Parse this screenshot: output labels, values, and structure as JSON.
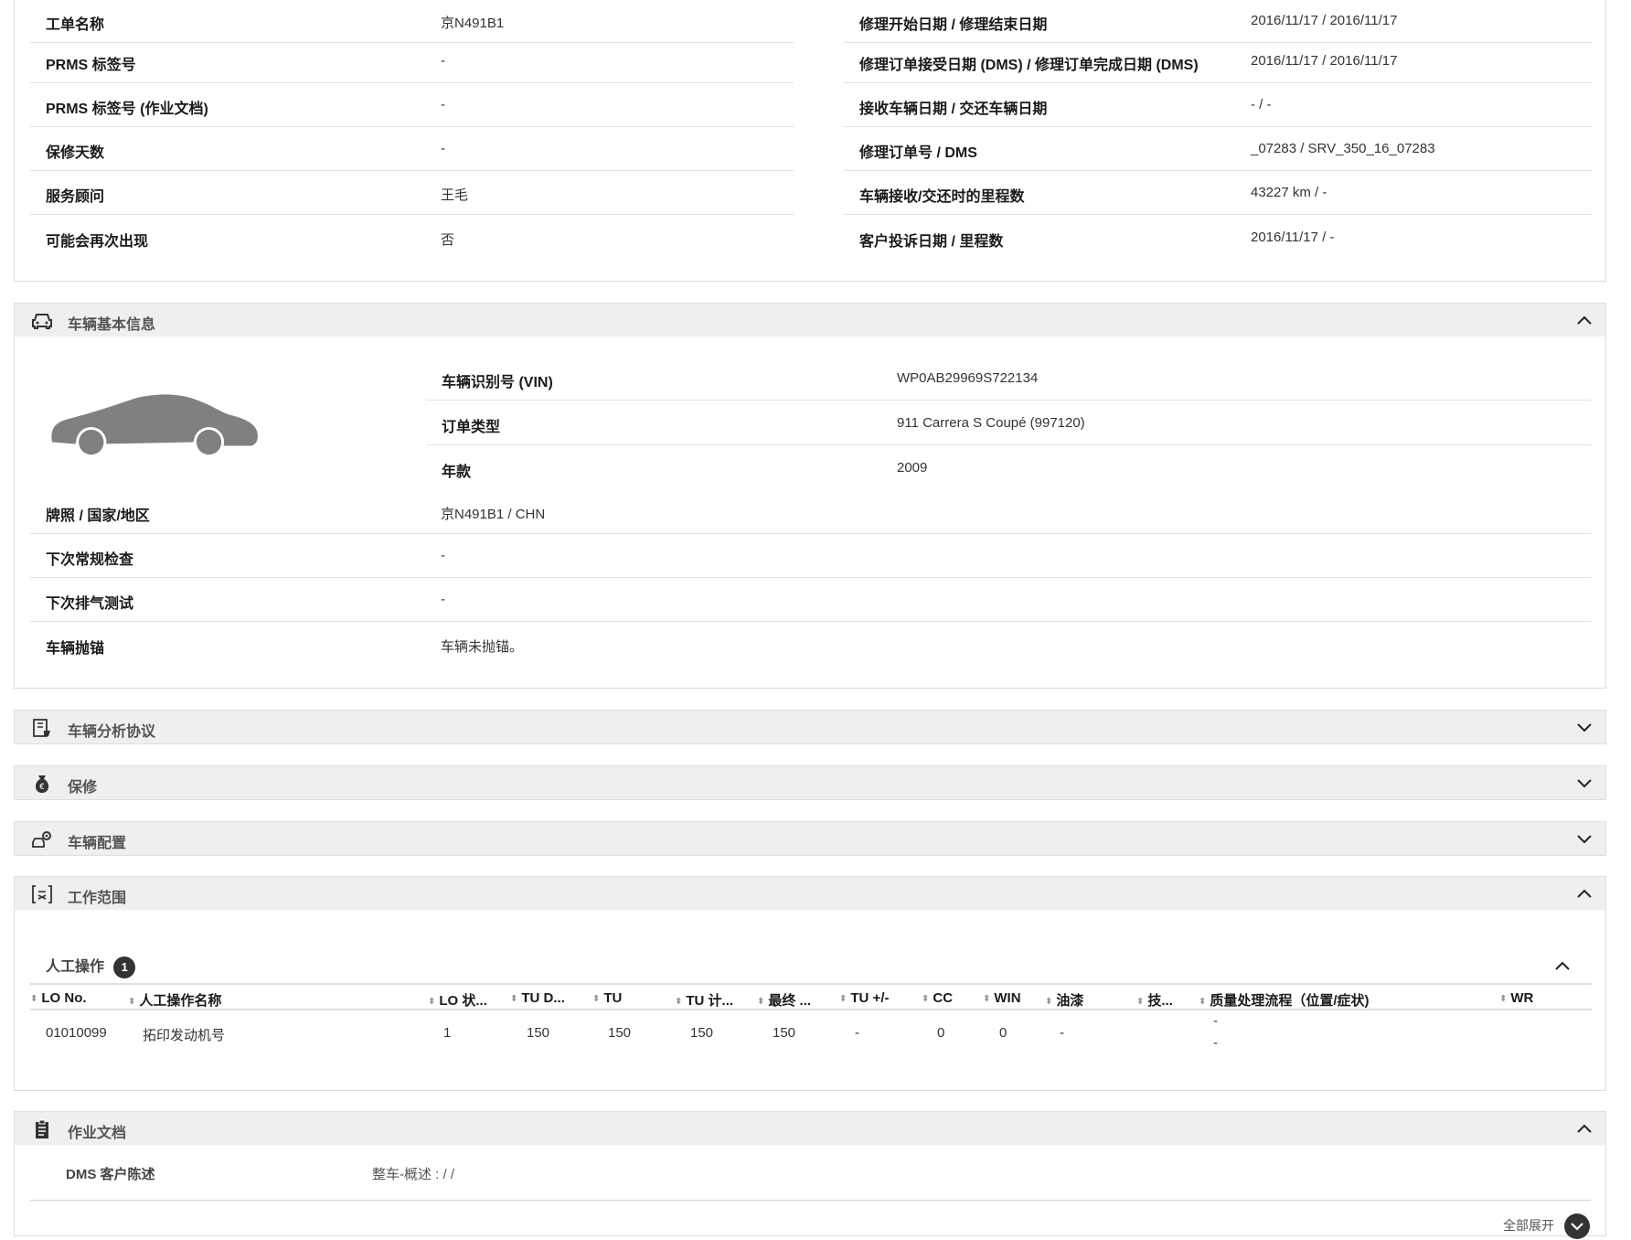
{
  "repair_info": {
    "left": [
      {
        "label": "工单名称",
        "value": "京N491B1"
      },
      {
        "label": "PRMS 标签号",
        "value": "-"
      },
      {
        "label": "PRMS 标签号 (作业文档)",
        "value": "-"
      },
      {
        "label": "保修天数",
        "value": "-"
      },
      {
        "label": "服务顾问",
        "value": "王毛"
      },
      {
        "label": "可能会再次出现",
        "value": "否"
      }
    ],
    "right": [
      {
        "label": "修理开始日期 / 修理结束日期",
        "value": "2016/11/17 / 2016/11/17"
      },
      {
        "label": "修理订单接受日期 (DMS) / 修理订单完成日期 (DMS)",
        "value": "2016/11/17 / 2016/11/17"
      },
      {
        "label": "接收车辆日期 / 交还车辆日期",
        "value": "- / -"
      },
      {
        "label": "修理订单号 / DMS",
        "value": "_07283 / SRV_350_16_07283"
      },
      {
        "label": "车辆接收/交还时的里程数",
        "value": "43227 km / -"
      },
      {
        "label": "客户投诉日期 / 里程数",
        "value": "2016/11/17 / -"
      }
    ]
  },
  "vehicle": {
    "title": "车辆基本信息",
    "top_rows": [
      {
        "label": "车辆识别号 (VIN)",
        "value": "WP0AB29969S722134"
      },
      {
        "label": "订单类型",
        "value": "911 Carrera S Coupé (997120)"
      },
      {
        "label": "年款",
        "value": "2009"
      }
    ],
    "rows": [
      {
        "label": "牌照 / 国家/地区",
        "value": "京N491B1 / CHN"
      },
      {
        "label": "下次常规检查",
        "value": "-"
      },
      {
        "label": "下次排气测试",
        "value": "-"
      },
      {
        "label": "车辆抛锚",
        "value": "车辆未抛锚。"
      }
    ]
  },
  "panels": {
    "analysis": "车辆分析协议",
    "warranty": "保修",
    "config": "车辆配置",
    "scope": "工作范围",
    "docs": "作业文档"
  },
  "labor": {
    "title": "人工操作",
    "count": "1",
    "headers": [
      "LO No.",
      "人工操作名称",
      "LO 状...",
      "TU D...",
      "TU",
      "TU 计...",
      "最终 ...",
      "TU +/-",
      "CC",
      "WIN",
      "油漆",
      "技...",
      "质量处理流程（位置/症状)",
      "WR"
    ],
    "row": {
      "lo_no": "01010099",
      "name": "拓印发动机号",
      "lo_status": "1",
      "tu_d": "150",
      "tu": "150",
      "tu_calc": "150",
      "final": "150",
      "tu_pm": "-",
      "cc": "0",
      "win": "0",
      "paint": "-",
      "qp_1": "-",
      "qp_2": "-"
    }
  },
  "docs": {
    "label": "DMS 客户陈述",
    "value": "整车-概述 : / /",
    "expand_all": "全部展开"
  }
}
